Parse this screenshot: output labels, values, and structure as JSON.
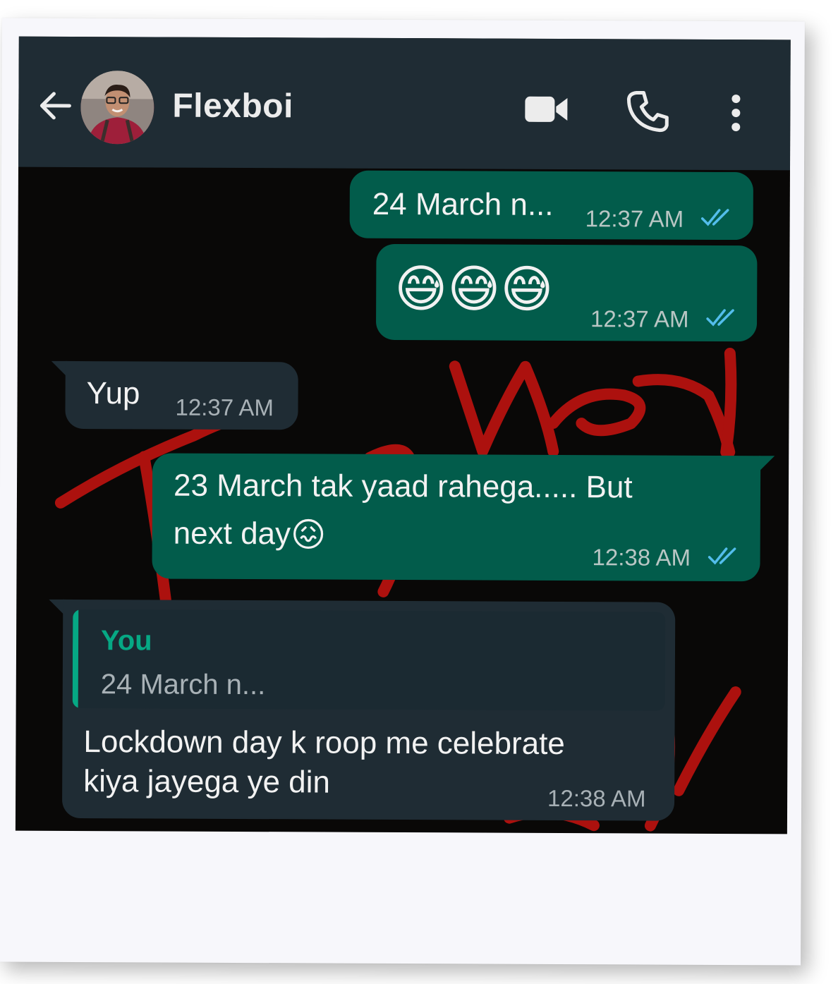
{
  "header": {
    "contact_name": "Flexboi",
    "icons": [
      "back-arrow-icon",
      "avatar",
      "video-call-icon",
      "phone-icon",
      "more-options-icon"
    ]
  },
  "colors": {
    "header_bg": "#1f2c34",
    "outgoing_bubble": "#025c4b",
    "incoming_bubble": "#1f2c34",
    "read_ticks": "#53bdeb",
    "quote_accent": "#06a884",
    "scribble": "#c0120f"
  },
  "messages": [
    {
      "direction": "outgoing",
      "text": "24 March n...",
      "time": "12:37 AM",
      "status": "read"
    },
    {
      "direction": "outgoing",
      "emoji": "😅😅😅",
      "time": "12:37 AM",
      "status": "read"
    },
    {
      "direction": "incoming",
      "text": "Yup",
      "time": "12:37 AM"
    },
    {
      "direction": "outgoing",
      "line1": "23 March tak yaad rahega..... But",
      "line2": "next day",
      "emoji": "😖",
      "time": "12:38 AM",
      "status": "read"
    },
    {
      "direction": "incoming",
      "quote": {
        "author": "You",
        "text": "24 March n..."
      },
      "line1": "Lockdown day k roop me celebrate",
      "line2": "kiya jayega ye din",
      "time": "12:38 AM"
    }
  ]
}
